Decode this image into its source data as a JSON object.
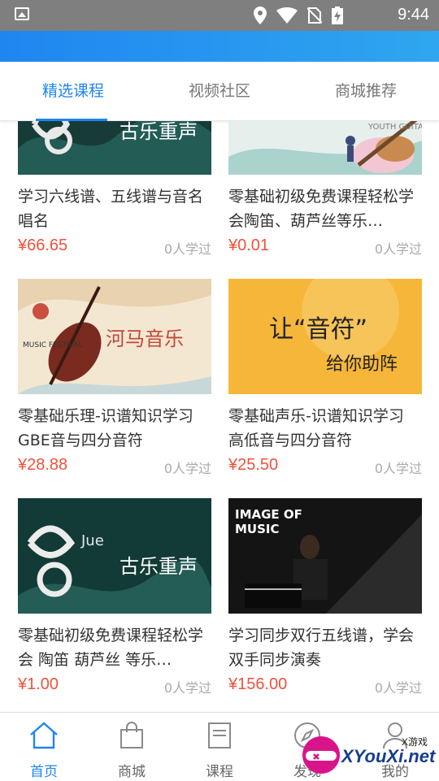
{
  "status_bar": {
    "time": "9:44"
  },
  "tabs": [
    {
      "label": "精选课程"
    },
    {
      "label": "视频社区"
    },
    {
      "label": "商城推荐"
    }
  ],
  "courses": [
    {
      "title": "学习六线谱、五线谱与音名 唱名",
      "price": "¥66.65",
      "learners": "0人学过",
      "image_text": "古乐重声"
    },
    {
      "title": "零基础初级免费课程轻松学会陶笛、葫芦丝等乐…",
      "price": "¥0.01",
      "learners": "0人学过",
      "image_text": "YOUTH GUITAR"
    },
    {
      "title": "零基础乐理-识谱知识学习GBE音与四分音符",
      "price": "¥28.88",
      "learners": "0人学过",
      "image_text": "河马音乐",
      "image_subtext": "MUSIC FESTIVAL"
    },
    {
      "title": "零基础声乐-识谱知识学习 高低音与四分音符",
      "price": "¥25.50",
      "learners": "0人学过",
      "image_text_line1": "让“音符”",
      "image_text_line2": "给你助阵"
    },
    {
      "title": "零基础初级免费课程轻松学会 陶笛 葫芦丝 等乐…",
      "price": "¥1.00",
      "learners": "0人学过",
      "image_text": "古乐重声",
      "image_subtext": "Jue"
    },
    {
      "title": "学习同步双行五线谱，学会 双手同步演奏",
      "price": "¥156.00",
      "learners": "0人学过",
      "image_text_line1": "IMAGE OF",
      "image_text_line2": "MUSIC"
    }
  ],
  "bottom_nav": [
    {
      "label": "首页",
      "icon": "home-icon"
    },
    {
      "label": "商城",
      "icon": "shopping-bag-icon"
    },
    {
      "label": "课程",
      "icon": "book-icon"
    },
    {
      "label": "发现",
      "icon": "compass-icon"
    },
    {
      "label": "我的",
      "icon": "user-icon"
    }
  ],
  "watermark": {
    "small": "X游戏",
    "brand": "XYouXi.net"
  },
  "colors": {
    "accent": "#1f86f0",
    "price": "#f0523b",
    "statusbar": "#7f7f7f"
  }
}
